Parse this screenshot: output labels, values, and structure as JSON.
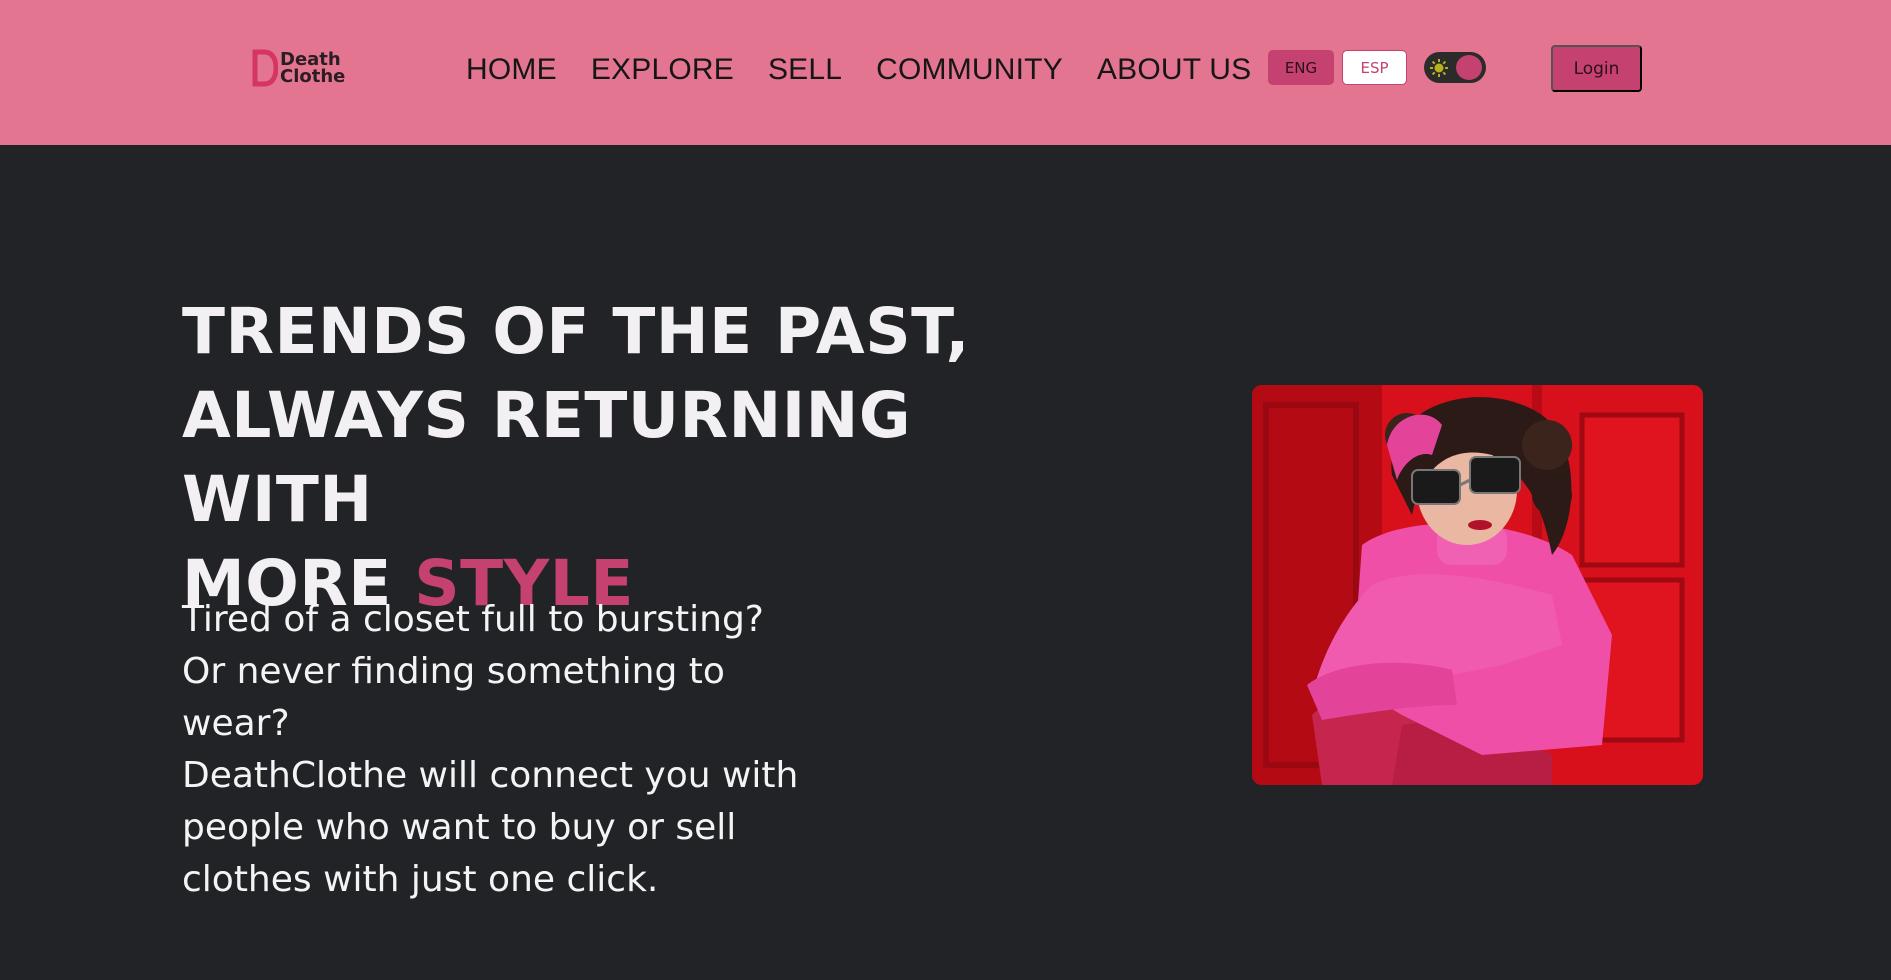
{
  "brand": {
    "name_line1": "Death",
    "name_line2": "Clothe",
    "logo_icon": "d-logo-mark",
    "accent_color": "#c5416f",
    "header_color": "#e37591",
    "background_color": "#222327"
  },
  "nav": {
    "items": [
      {
        "label": "HOME"
      },
      {
        "label": "EXPLORE"
      },
      {
        "label": "SELL"
      },
      {
        "label": "COMMUNITY"
      },
      {
        "label": "ABOUT US"
      }
    ]
  },
  "language": {
    "eng_label": "ENG",
    "esp_label": "ESP",
    "selected": "ENG"
  },
  "theme_toggle": {
    "icon": "sun-icon",
    "state": "dark"
  },
  "auth": {
    "login_label": "Login"
  },
  "hero": {
    "headline_line1": "TRENDS OF THE PAST,",
    "headline_line2": "ALWAYS RETURNING WITH",
    "headline_line3_prefix": "MORE ",
    "headline_accent": "STYLE",
    "intro_paragraph1": "Tired of a closet full to bursting? Or never finding something to wear?",
    "intro_paragraph2": "DeathClothe will connect you with people who want to buy or sell clothes with just one click.",
    "image_subject": "woman in pink lace top and sunglasses against red door"
  }
}
